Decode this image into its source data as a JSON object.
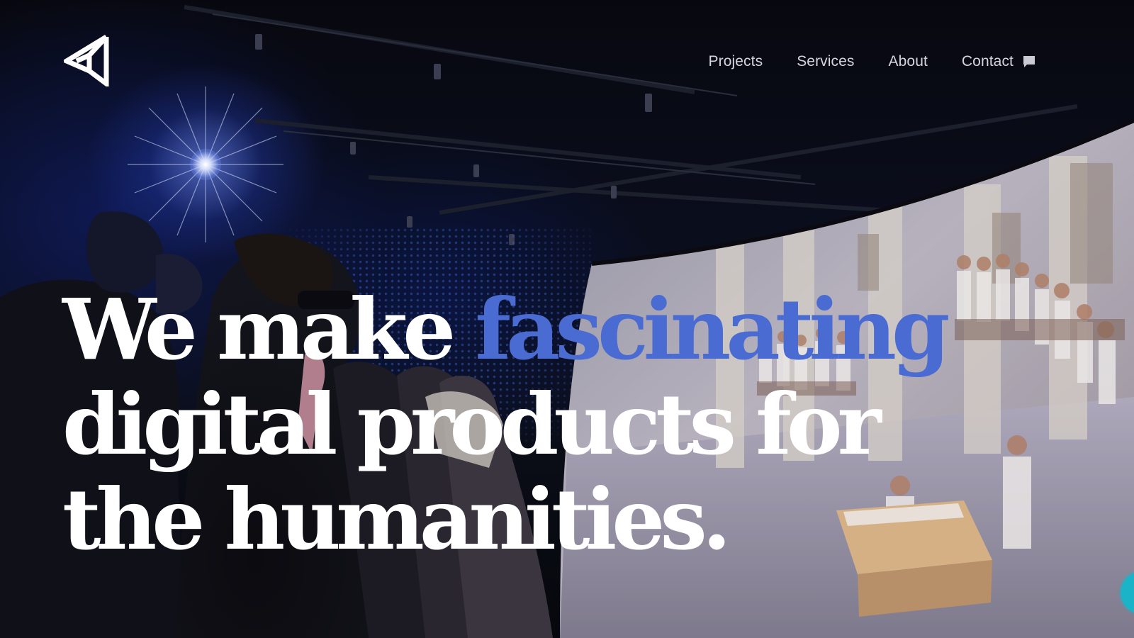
{
  "brand": {
    "logo_icon": "folded-arrow-logo-icon"
  },
  "nav": {
    "items": [
      {
        "label": "Projects"
      },
      {
        "label": "Services"
      },
      {
        "label": "About"
      },
      {
        "label": "Contact",
        "icon": "chat-bubble-icon"
      }
    ]
  },
  "hero": {
    "line1_start": "We make ",
    "line1_accent": "fascinating",
    "line2": "digital products for",
    "line3": "the humanities."
  },
  "colors": {
    "accent": "#4a6bd1",
    "nav_text": "#d5d6dc",
    "headline": "#ffffff",
    "chat_widget": "#1bb3c7"
  },
  "chat_widget": {
    "icon": "chat-launcher-icon"
  }
}
